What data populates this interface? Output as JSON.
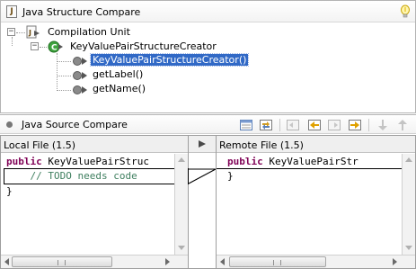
{
  "structure": {
    "title": "Java Structure Compare",
    "tree": {
      "root_label": "Compilation Unit",
      "class_label": "KeyValuePairStructureCreator",
      "methods": [
        "KeyValuePairStructureCreator()",
        "getLabel()",
        "getName()"
      ]
    }
  },
  "source": {
    "title": "Java Source Compare"
  },
  "left": {
    "title": "Local File (1.5)",
    "line1_keyword": "public",
    "line1_text": " KeyValuePairStruc",
    "line2_comment": "    // TODO needs code",
    "line3": "}"
  },
  "right": {
    "title": "Remote File (1.5)",
    "line1_keyword": "public",
    "line1_text": " KeyValuePairStr",
    "line2": "}"
  },
  "colors": {
    "keyword": "#7f0055",
    "comment": "#3f7f5f",
    "selection": "#3169c6"
  }
}
